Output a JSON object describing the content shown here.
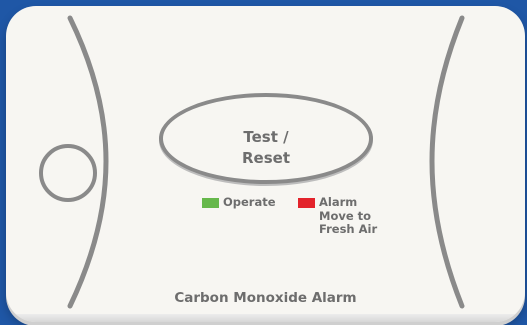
{
  "device": {
    "title": "Carbon Monoxide Alarm",
    "test_button": {
      "line1": "Test /",
      "line2": "Reset"
    },
    "indicators": {
      "operate": {
        "label": "Operate",
        "color": "#66b84b"
      },
      "alarm": {
        "label": "Alarm",
        "sub1": "Move to",
        "sub2": "Fresh Air",
        "color": "#e3232b"
      }
    }
  },
  "colors": {
    "background": "#1f57a6",
    "device_face": "#f7f6f2",
    "outline": "#8a8a8a",
    "text": "#6d6d6d"
  }
}
